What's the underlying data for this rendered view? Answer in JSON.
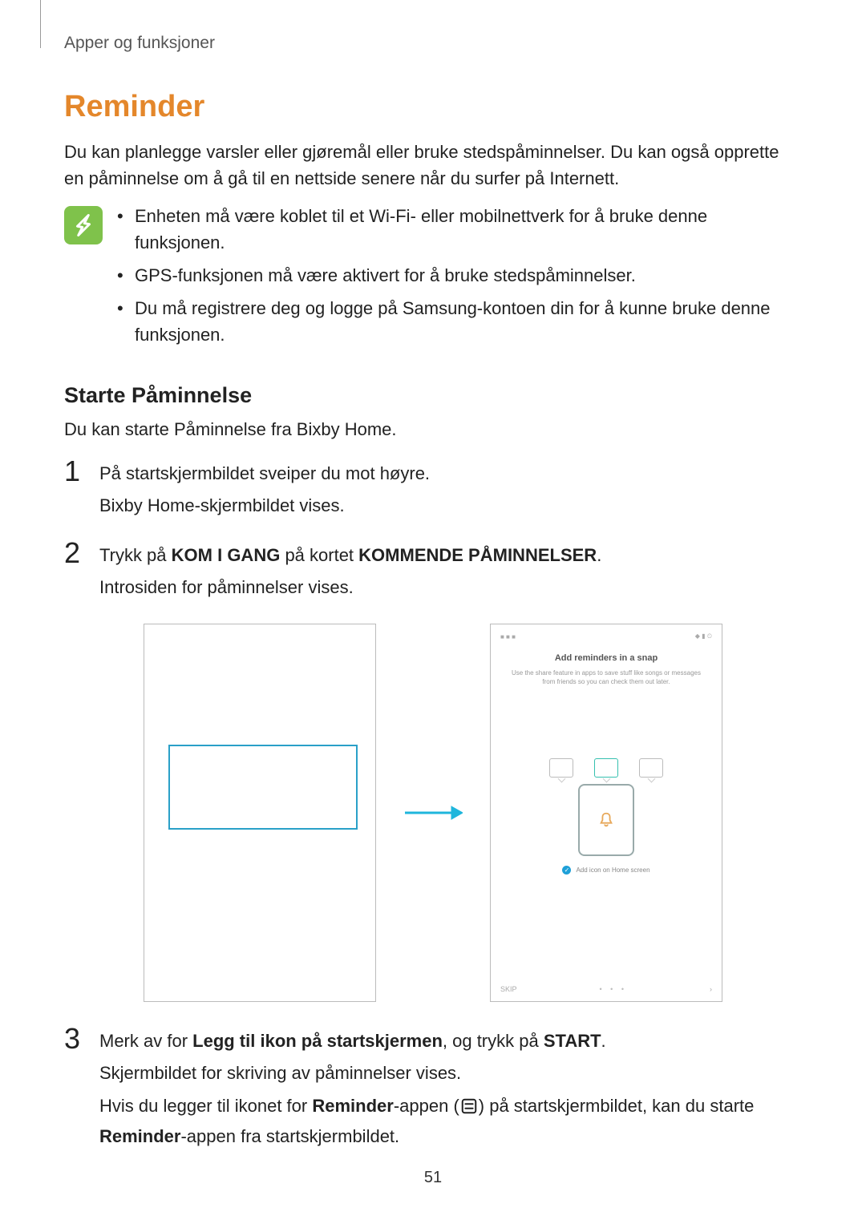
{
  "breadcrumb": "Apper og funksjoner",
  "title": "Reminder",
  "intro": "Du kan planlegge varsler eller gjøremål eller bruke stedspåminnelser. Du kan også opprette en påminnelse om å gå til en nettside senere når du surfer på Internett.",
  "notes": [
    "Enheten må være koblet til et Wi-Fi- eller mobilnettverk for å bruke denne funksjonen.",
    "GPS-funksjonen må være aktivert for å bruke stedspåminnelser.",
    "Du må registrere deg og logge på Samsung-kontoen din for å kunne bruke denne funksjonen."
  ],
  "subsection": {
    "title": "Starte Påminnelse",
    "intro": "Du kan starte Påminnelse fra Bixby Home."
  },
  "steps": {
    "s1": {
      "num": "1",
      "line1": "På startskjermbildet sveiper du mot høyre.",
      "line2": "Bixby Home-skjermbildet vises."
    },
    "s2": {
      "num": "2",
      "line1_pre": "Trykk på ",
      "line1_b1": "KOM I GANG",
      "line1_mid": " på kortet ",
      "line1_b2": "KOMMENDE PÅMINNELSER",
      "line1_post": ".",
      "line2": "Introsiden for påminnelser vises."
    },
    "s3": {
      "num": "3",
      "line1_pre": "Merk av for ",
      "line1_b1": "Legg til ikon på startskjermen",
      "line1_mid": ", og trykk på ",
      "line1_b2": "START",
      "line1_post": ".",
      "line2": "Skjermbildet for skriving av påminnelser vises.",
      "line3_pre": "Hvis du legger til ikonet for ",
      "line3_b1": "Reminder",
      "line3_mid1": "-appen (",
      "line3_mid2": ") på startskjermbildet, kan du starte ",
      "line3_b2": "Reminder",
      "line3_post": "-appen fra startskjermbildet."
    }
  },
  "mock2": {
    "title": "Add reminders in a snap",
    "sub": "Use the share feature in apps to save stuff like songs or messages from friends so you can check them out later.",
    "check_label": "Add icon on Home screen",
    "skip": "SKIP",
    "start_chevron": "›"
  },
  "page_number": "51"
}
